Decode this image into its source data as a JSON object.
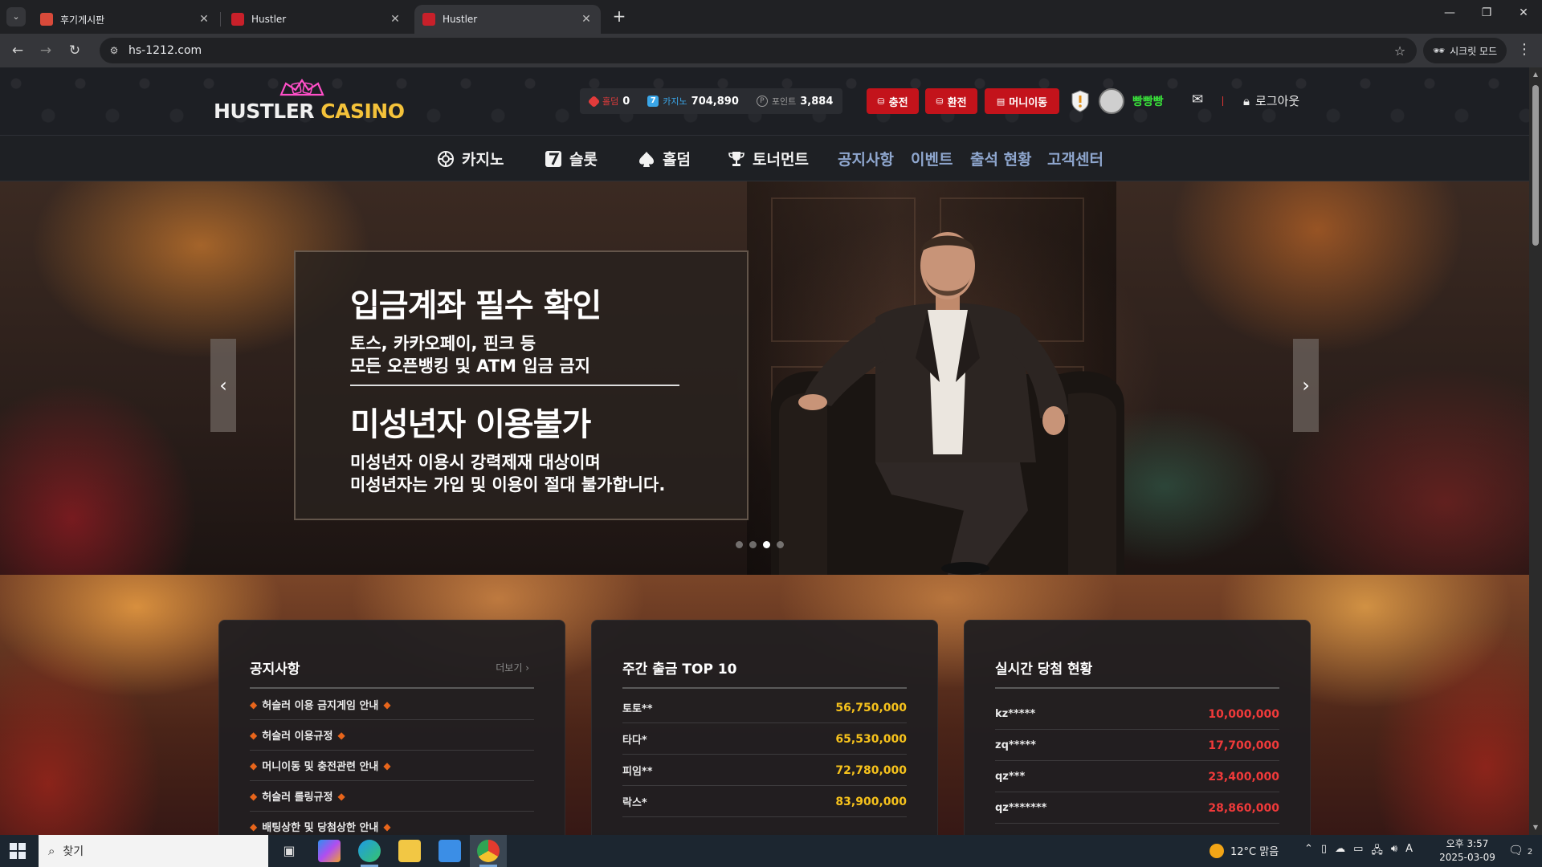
{
  "browser": {
    "tabs": [
      {
        "title": "후기게시판",
        "active": false,
        "favicon_color": "#d84a3a"
      },
      {
        "title": "Hustler",
        "active": false,
        "favicon_color": "#c8202a"
      },
      {
        "title": "Hustler",
        "active": true,
        "favicon_color": "#c8202a"
      }
    ],
    "url": "hs-1212.com",
    "incognito_label": "시크릿 모드"
  },
  "header": {
    "logo_word1": "HUSTLER",
    "logo_word2": "CASINO",
    "balances": [
      {
        "label": "홀덤",
        "value": "0",
        "icon": "spade-red-icon",
        "color": "#e23b3b"
      },
      {
        "label": "카지노",
        "value": "704,890",
        "icon": "seven-icon",
        "color": "#3aa6e8"
      },
      {
        "label": "포인트",
        "value": "3,884",
        "icon": "point-coin-icon",
        "color": "#9a9a9a"
      }
    ],
    "buttons": {
      "deposit": "충전",
      "withdraw": "환전",
      "money_transfer": "머니이동"
    },
    "nickname": "빵빵빵",
    "logout": "로그아웃"
  },
  "nav": [
    {
      "label": "카지노",
      "icon": "casino-chip-icon",
      "style": "white"
    },
    {
      "label": "슬롯",
      "icon": "slot-seven-icon",
      "style": "white"
    },
    {
      "label": "홀덤",
      "icon": "spade-icon",
      "style": "white"
    },
    {
      "label": "토너먼트",
      "icon": "trophy-icon",
      "style": "white"
    },
    {
      "label": "공지사항",
      "icon": "",
      "style": "blue"
    },
    {
      "label": "이벤트",
      "icon": "",
      "style": "blue"
    },
    {
      "label": "출석 현황",
      "icon": "",
      "style": "blue"
    },
    {
      "label": "고객센터",
      "icon": "",
      "style": "blue"
    }
  ],
  "banner": {
    "headline1": "입금계좌 필수 확인",
    "line1": "토스, 카카오페이, 핀크 등",
    "line2": "모든 오픈뱅킹 및 ATM 입금 금지",
    "headline2": "미성년자 이용불가",
    "line3": "미성년자 이용시 강력제재 대상이며",
    "line4": "미성년자는 가입 및 이용이 절대 불가합니다.",
    "slide_count": 4,
    "active_slide": 3
  },
  "notices": {
    "title": "공지사항",
    "more": "더보기",
    "items": [
      "허슬러 이용 금지게임 안내",
      "허슬러 이용규정",
      "머니이동 및 충전관련 안내",
      "허슬러 롤링규정",
      "배팅상한 및 당첨상한 안내"
    ]
  },
  "weekly_top": {
    "title": "주간 출금 TOP 10",
    "amount_color": "#f6c21c",
    "rows": [
      {
        "name": "토토**",
        "amount": "56,750,000"
      },
      {
        "name": "타다*",
        "amount": "65,530,000"
      },
      {
        "name": "피임**",
        "amount": "72,780,000"
      },
      {
        "name": "락스*",
        "amount": "83,900,000"
      }
    ]
  },
  "live_wins": {
    "title": "실시간 당첨 현황",
    "amount_color": "#f03a3a",
    "rows": [
      {
        "name": "kz*****",
        "amount": "10,000,000"
      },
      {
        "name": "zq*****",
        "amount": "17,700,000"
      },
      {
        "name": "qz***",
        "amount": "23,400,000"
      },
      {
        "name": "qz*******",
        "amount": "28,860,000"
      }
    ]
  },
  "taskbar": {
    "search_placeholder": "찾기",
    "weather": "12°C 맑음",
    "time": "오후 3:57",
    "date": "2025-03-09",
    "ime": "A",
    "notification_count": "2"
  }
}
